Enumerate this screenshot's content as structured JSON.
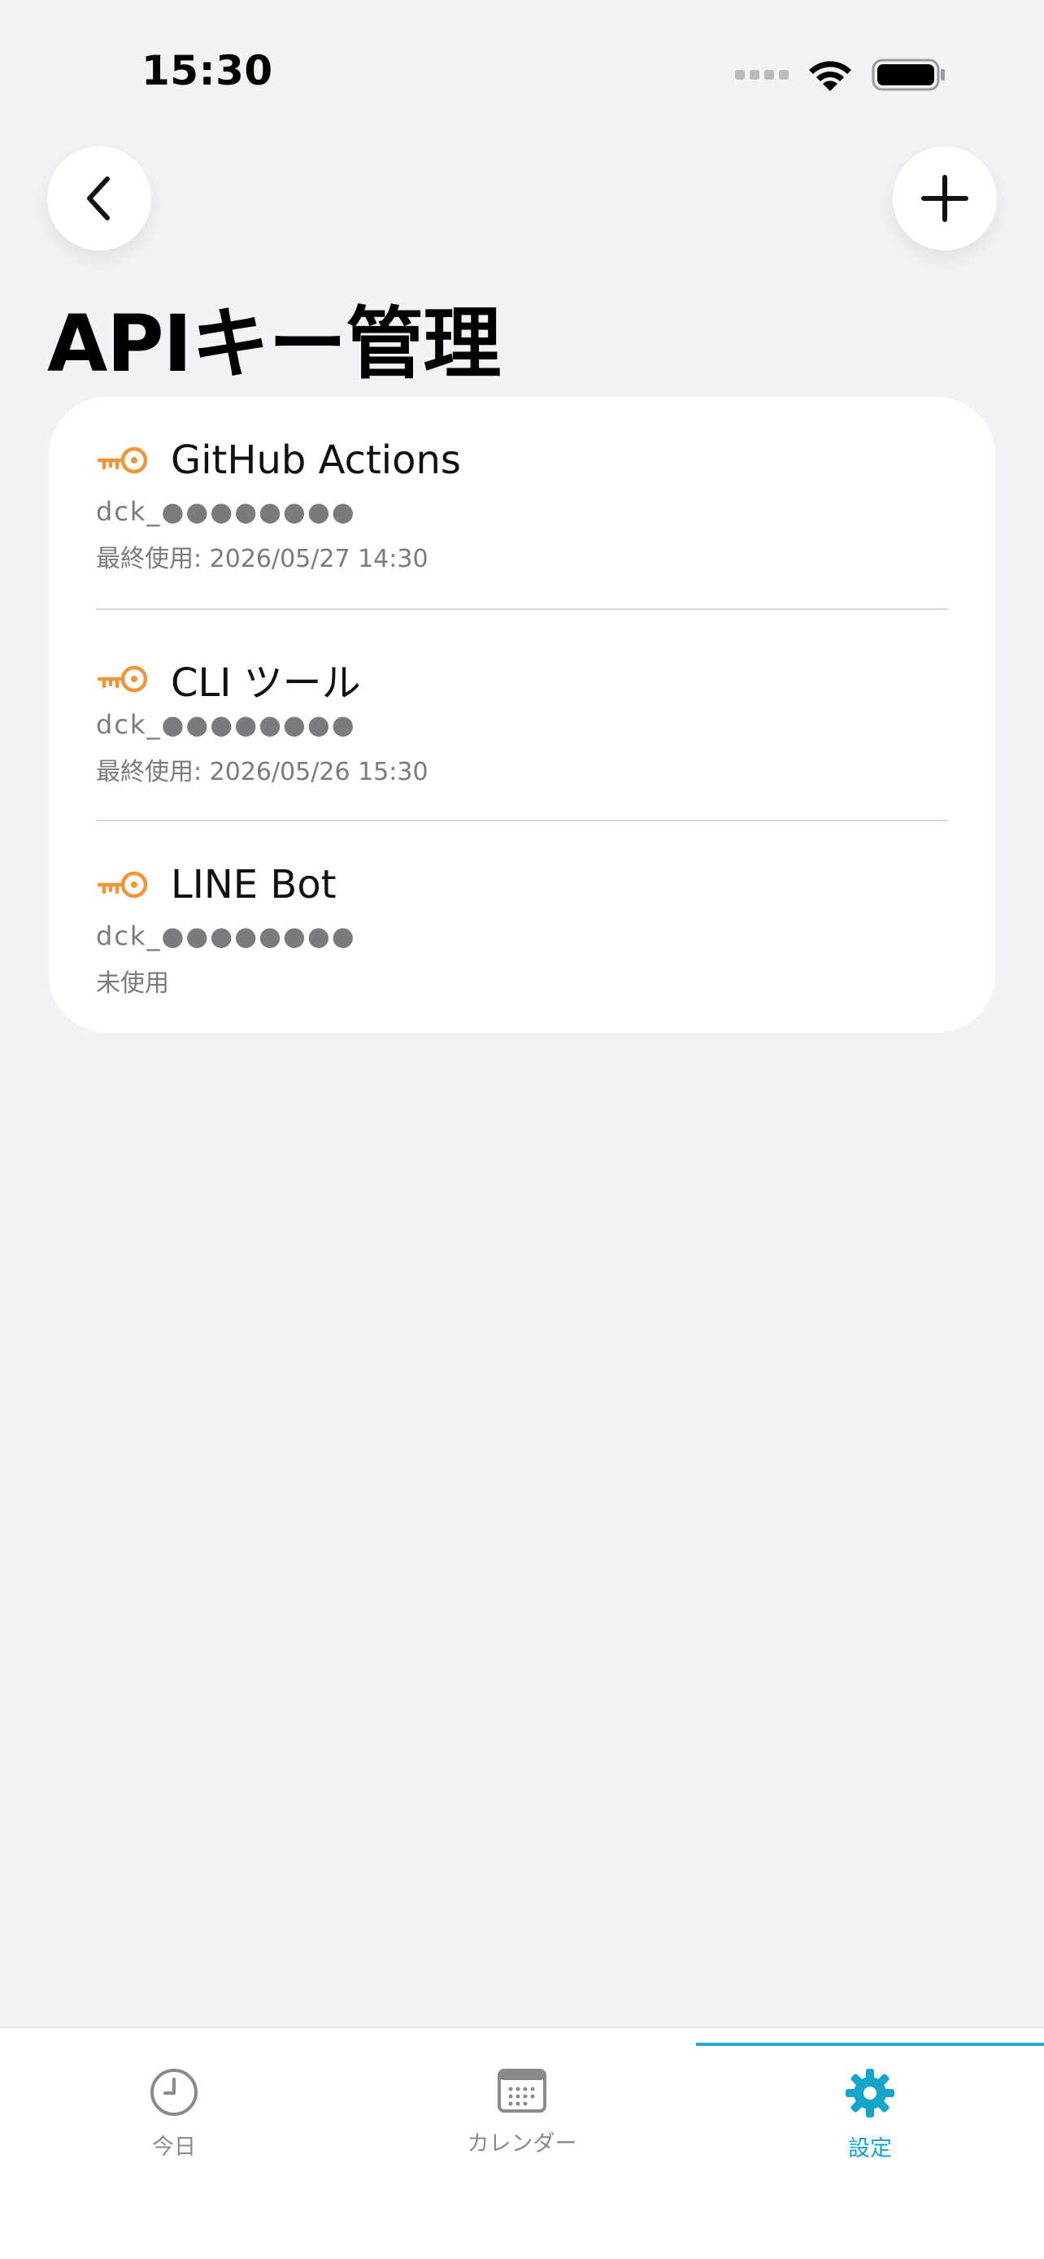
{
  "status": {
    "time": "15:30"
  },
  "page": {
    "title": "APIキー管理"
  },
  "keys": [
    {
      "name": "GitHub Actions",
      "masked": "dck_●●●●●●●●",
      "last_used": "最終使用: 2026/05/27 14:30"
    },
    {
      "name": "CLI ツール",
      "masked": "dck_●●●●●●●●",
      "last_used": "最終使用: 2026/05/26 15:30"
    },
    {
      "name": "LINE Bot",
      "masked": "dck_●●●●●●●●",
      "last_used": "未使用"
    }
  ],
  "tabs": [
    {
      "label": "今日",
      "icon": "clock-icon",
      "active": false
    },
    {
      "label": "カレンダー",
      "icon": "calendar-icon",
      "active": false
    },
    {
      "label": "設定",
      "icon": "gear-icon",
      "active": true
    }
  ],
  "colors": {
    "accent": "#13A6C9",
    "key_icon": "#F0953A",
    "background": "#F2F2F7"
  }
}
